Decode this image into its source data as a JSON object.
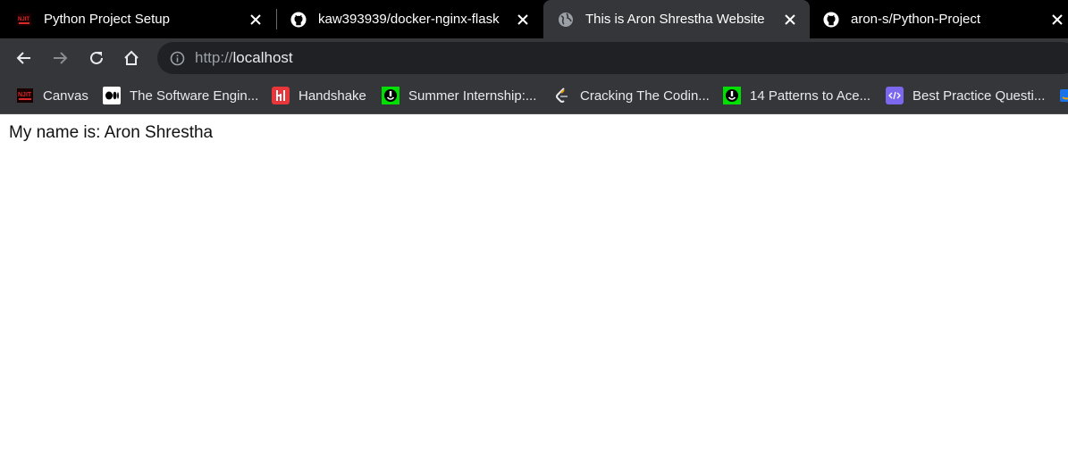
{
  "tabs": [
    {
      "title": "Python Project Setup",
      "favicon": "njit-logo-icon",
      "active": false
    },
    {
      "title": "kaw393939/docker-nginx-flask",
      "favicon": "github-icon",
      "active": false
    },
    {
      "title": "This is Aron Shrestha Website",
      "favicon": "globe-icon",
      "active": true
    },
    {
      "title": "aron-s/Python-Project",
      "favicon": "github-icon",
      "active": false
    }
  ],
  "toolbar": {
    "url_scheme": "http://",
    "url_host": "localhost"
  },
  "bookmarks": [
    {
      "label": "Canvas",
      "icon": "njit-logo-icon"
    },
    {
      "label": "The Software Engin...",
      "icon": "medium-icon"
    },
    {
      "label": "Handshake",
      "icon": "handshake-icon"
    },
    {
      "label": "Summer Internship:...",
      "icon": "green-app-icon"
    },
    {
      "label": "Cracking The Codin...",
      "icon": "leetcode-icon"
    },
    {
      "label": "14 Patterns to Ace...",
      "icon": "green-app-icon"
    },
    {
      "label": "Best Practice Questi...",
      "icon": "code-icon"
    }
  ],
  "page": {
    "text": "My name is: Aron Shrestha"
  },
  "colors": {
    "tabstrip": "#000000",
    "toolbar": "#35363a",
    "omnibox": "#202124",
    "page_bg": "#ffffff"
  }
}
